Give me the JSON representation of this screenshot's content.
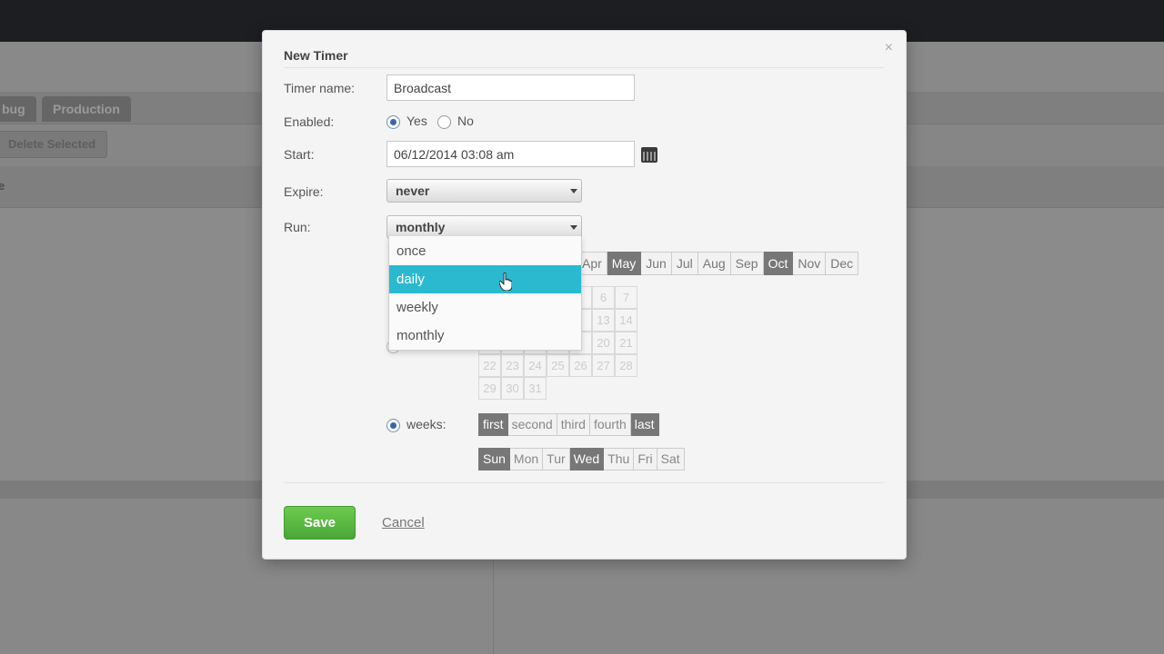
{
  "background": {
    "tabs": [
      "bug",
      "Production"
    ],
    "toolbar_button": "Delete Selected",
    "header_text": "e"
  },
  "modal": {
    "title": "New Timer",
    "close_label": "×",
    "timer_name_label": "Timer name:",
    "timer_name_value": "Broadcast",
    "enabled_label": "Enabled:",
    "enabled_yes": "Yes",
    "enabled_no": "No",
    "enabled_selected": "Yes",
    "start_label": "Start:",
    "start_value": "06/12/2014 03:08 am",
    "expire_label": "Expire:",
    "expire_value": "never",
    "run_label": "Run:",
    "run_value": "monthly",
    "run_options": [
      "once",
      "daily",
      "weekly",
      "monthly"
    ],
    "run_highlighted": "daily",
    "months": [
      {
        "label": "Apr",
        "selected": false
      },
      {
        "label": "May",
        "selected": true
      },
      {
        "label": "Jun",
        "selected": false
      },
      {
        "label": "Jul",
        "selected": false
      },
      {
        "label": "Aug",
        "selected": false
      },
      {
        "label": "Sep",
        "selected": false
      },
      {
        "label": "Oct",
        "selected": true
      },
      {
        "label": "Nov",
        "selected": false
      },
      {
        "label": "Dec",
        "selected": false
      }
    ],
    "days_visible": [
      [
        "",
        "",
        "",
        "",
        "",
        "6",
        "7"
      ],
      [
        "",
        "",
        "",
        "",
        "",
        "13",
        "14"
      ],
      [
        "",
        "",
        "",
        "",
        "",
        "20",
        "21"
      ],
      [
        "22",
        "23",
        "24",
        "25",
        "26",
        "27",
        "28"
      ],
      [
        "29",
        "30",
        "31"
      ]
    ],
    "weeks_label": "weeks:",
    "weeks_selected": true,
    "week_options": [
      {
        "label": "first",
        "selected": true
      },
      {
        "label": "second",
        "selected": false
      },
      {
        "label": "third",
        "selected": false
      },
      {
        "label": "fourth",
        "selected": false
      },
      {
        "label": "last",
        "selected": true
      }
    ],
    "weekday_options": [
      {
        "label": "Sun",
        "selected": true
      },
      {
        "label": "Mon",
        "selected": false
      },
      {
        "label": "Tur",
        "selected": false
      },
      {
        "label": "Wed",
        "selected": true
      },
      {
        "label": "Thu",
        "selected": false
      },
      {
        "label": "Fri",
        "selected": false
      },
      {
        "label": "Sat",
        "selected": false
      }
    ],
    "save_label": "Save",
    "cancel_label": "Cancel"
  },
  "colors": {
    "save_green": "#4ba737",
    "highlight_teal": "#2bb9cf",
    "selected_gray": "#777777"
  }
}
